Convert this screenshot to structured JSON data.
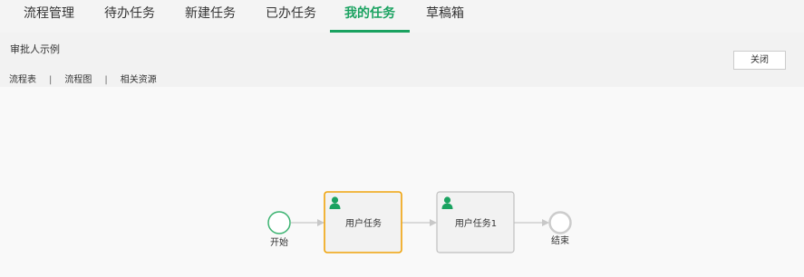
{
  "tabs": [
    {
      "label": "流程管理"
    },
    {
      "label": "待办任务"
    },
    {
      "label": "新建任务"
    },
    {
      "label": "已办任务"
    },
    {
      "label": "我的任务"
    },
    {
      "label": "草稿箱"
    }
  ],
  "header": {
    "title": "审批人示例",
    "close_label": "关闭"
  },
  "subnav": {
    "items": [
      {
        "label": "流程表"
      },
      {
        "label": "流程图"
      },
      {
        "label": "相关资源"
      }
    ],
    "separator": "|"
  },
  "diagram": {
    "start_label": "开始",
    "task1_label": "用户任务",
    "task2_label": "用户任务1",
    "end_label": "结束",
    "colors": {
      "start_border": "#3cb371",
      "selected_border": "#f0a30a",
      "task_border": "#c0c0c0",
      "end_border": "#cccccc",
      "user_icon": "#1aa260",
      "connector": "#c8c8c8"
    },
    "icons": [
      "user-icon",
      "arrow-icon"
    ]
  }
}
